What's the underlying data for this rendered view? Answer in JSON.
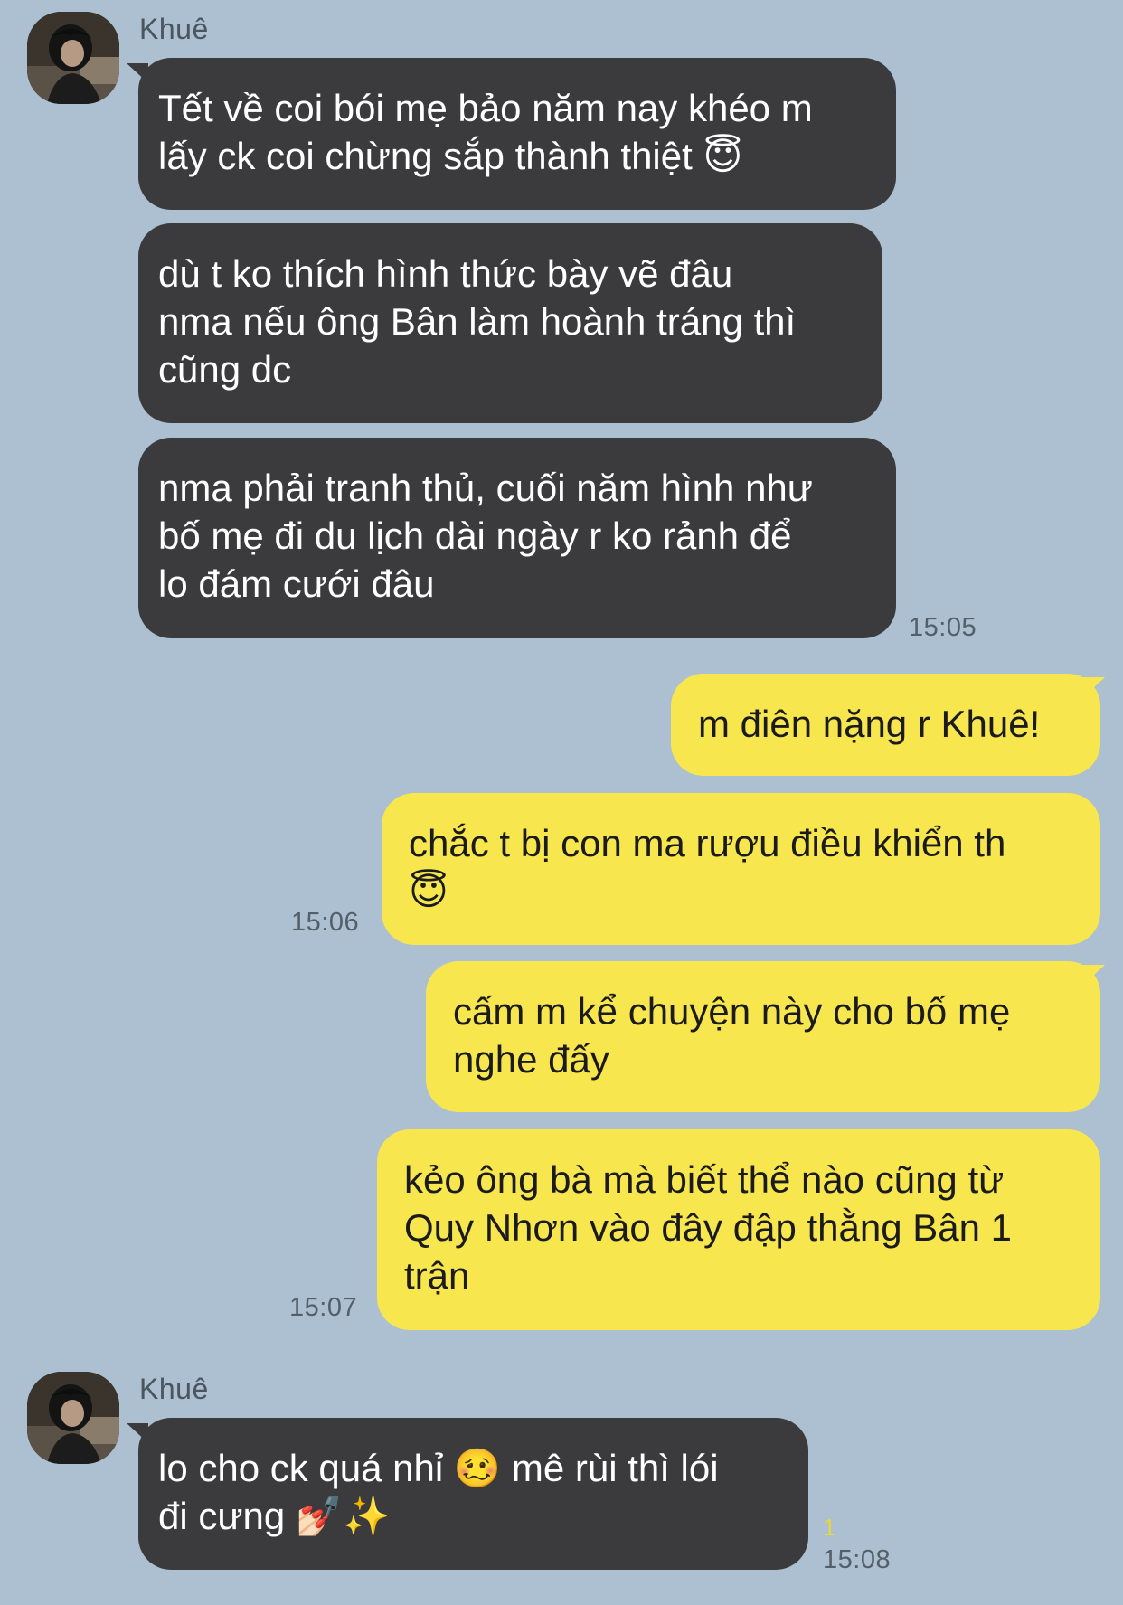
{
  "chat": {
    "contact_name": "Khuê",
    "group1": {
      "sender": "Khuê",
      "messages": [
        "Tết về coi bói mẹ bảo năm nay khéo m\nlấy ck coi chừng sắp thành thiệt 😇",
        "dù t ko thích hình thức bày vẽ đâu\nnma nếu ông Bân làm hoành tráng thì\ncũng dc",
        "nma phải tranh thủ, cuối năm hình như\nbố mẹ đi du lịch dài ngày r ko rảnh để\nlo đám cưới đâu"
      ],
      "time": "15:05"
    },
    "outgoing": {
      "messages": [
        "m điên nặng r Khuê!",
        "chắc t bị con ma rượu điều khiển th\n😇",
        "cấm m kể chuyện này cho bố mẹ\nnghe đấy",
        "kẻo ông bà mà biết thể nào cũng từ\nQuy Nhơn vào đây đập thằng Bân 1\ntrận"
      ],
      "time_1": "15:06",
      "time_2": "15:07"
    },
    "group2": {
      "sender": "Khuê",
      "messages": [
        "lo cho ck quá nhỉ 🥴 mê rùi thì lói\nđi cưng 💅🏻✨"
      ],
      "unread": "1",
      "time": "15:08"
    }
  },
  "colors": {
    "background": "#acc0d2",
    "incoming_bubble": "#3b3b3d",
    "outgoing_bubble": "#f7e64e"
  },
  "icons": {
    "avatar": "contact-avatar-photo"
  }
}
